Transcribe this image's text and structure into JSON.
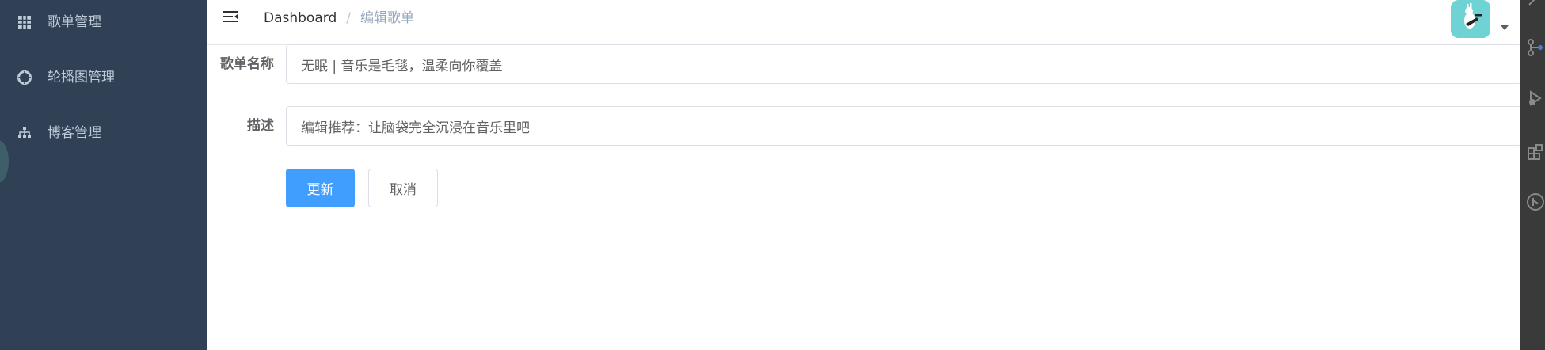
{
  "sidebar": {
    "items": [
      {
        "label": "歌单管理",
        "icon": "grid-icon"
      },
      {
        "label": "轮播图管理",
        "icon": "aperture-icon"
      },
      {
        "label": "博客管理",
        "icon": "sitemap-icon"
      }
    ]
  },
  "header": {
    "breadcrumb": {
      "home": "Dashboard",
      "separator": "/",
      "current": "编辑歌单"
    }
  },
  "form": {
    "name_label": "歌单名称",
    "name_value": "无眠 | 音乐是毛毯，温柔向你覆盖",
    "desc_label": "描述",
    "desc_value": "编辑推荐：让脑袋完全沉浸在音乐里吧",
    "update_button": "更新",
    "cancel_button": "取消"
  },
  "colors": {
    "sidebar_bg": "#304156",
    "sidebar_text": "#bfcbd9",
    "primary": "#409eff",
    "avatar_bg": "#6fd3d6",
    "rail_bg": "#3a3a3a"
  }
}
